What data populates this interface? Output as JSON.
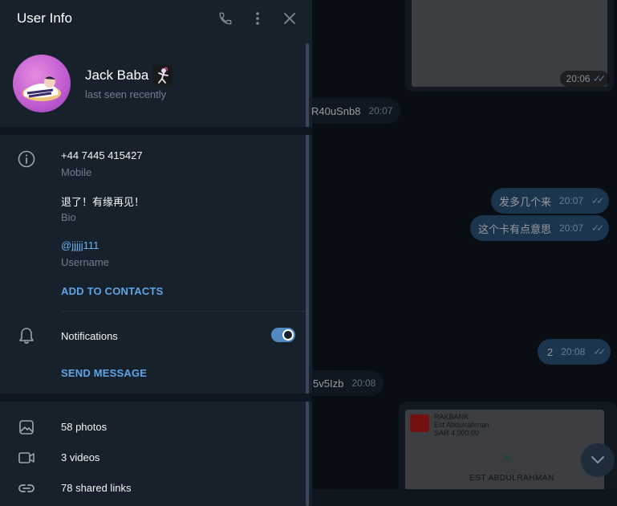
{
  "panel": {
    "title": "User Info",
    "icons": {
      "call": "phone-icon",
      "more": "more-vertical-icon",
      "close": "close-icon"
    },
    "user": {
      "name": "Jack Baba",
      "status": "last seen recently"
    },
    "info": {
      "phone": "+44 7445 415427",
      "phone_label": "Mobile",
      "bio": "退了！有缘再见！",
      "bio_label": "Bio",
      "username": "@jjjjj111",
      "username_label": "Username"
    },
    "add_contacts": "ADD TO CONTACTS",
    "notifications_label": "Notifications",
    "notifications_on": true,
    "send_message": "SEND MESSAGE",
    "media": {
      "photos": "58 photos",
      "videos": "3 videos",
      "links": "78 shared links"
    }
  },
  "chat": {
    "messages": [
      {
        "dir": "out",
        "kind": "image",
        "time": "20:06"
      },
      {
        "dir": "in",
        "text": "R40uSnb8",
        "time": "20:07"
      },
      {
        "dir": "out",
        "text": "发多几个来",
        "time": "20:07"
      },
      {
        "dir": "out",
        "text": "这个卡有点意思",
        "time": "20:07"
      },
      {
        "dir": "out",
        "text": "2",
        "time": "20:08"
      },
      {
        "dir": "in",
        "text": "5v5Izb",
        "time": "20:08"
      }
    ],
    "bank_card": {
      "bank": "RAKBANK",
      "holder": "Est Abdulrahman",
      "amount": "SAR 4,000.00",
      "footer": "EST ABDULRAHMAN"
    }
  },
  "colors": {
    "panel_bg": "#17212b",
    "chat_bg": "#0e1621",
    "accent": "#5288c1",
    "link": "#6ab3f3",
    "bubble_out": "#2b5278",
    "bubble_in": "#182533"
  }
}
